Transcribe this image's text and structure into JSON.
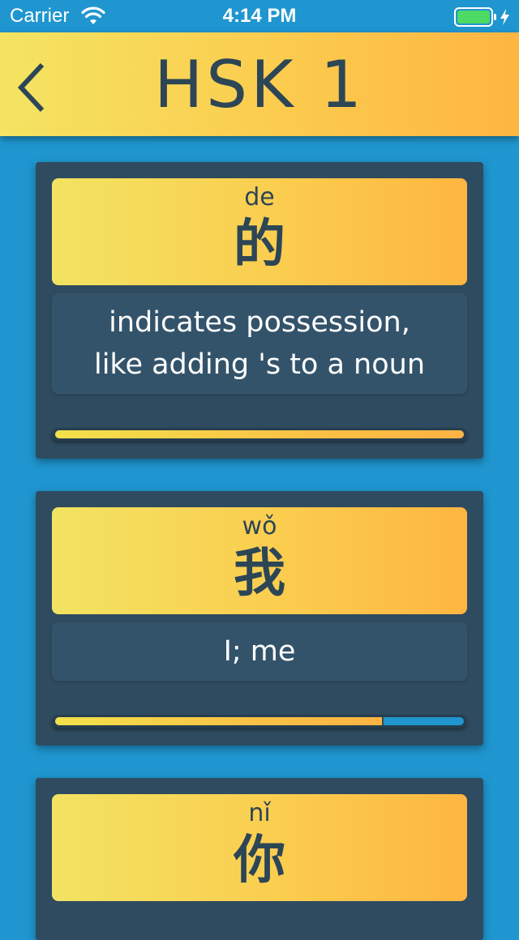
{
  "status_bar": {
    "carrier": "Carrier",
    "time": "4:14 PM",
    "wifi_icon": "wifi-icon",
    "battery_icon": "battery-charging-icon",
    "battery_color": "#4cd964"
  },
  "nav": {
    "title": "HSK 1",
    "back_icon": "chevron-left-icon"
  },
  "colors": {
    "background": "#1f96cf",
    "card": "#2f4b5f",
    "accent_start": "#f4e462",
    "accent_end": "#feb541",
    "text_dark": "#2d4656"
  },
  "cards": [
    {
      "pinyin": "de",
      "hanzi": "的",
      "meaning": "indicates possession,\nlike adding 's to a noun",
      "progress": 1.0
    },
    {
      "pinyin": "wǒ",
      "hanzi": "我",
      "meaning": "I; me",
      "progress": 0.8
    },
    {
      "pinyin": "nǐ",
      "hanzi": "你"
    }
  ]
}
